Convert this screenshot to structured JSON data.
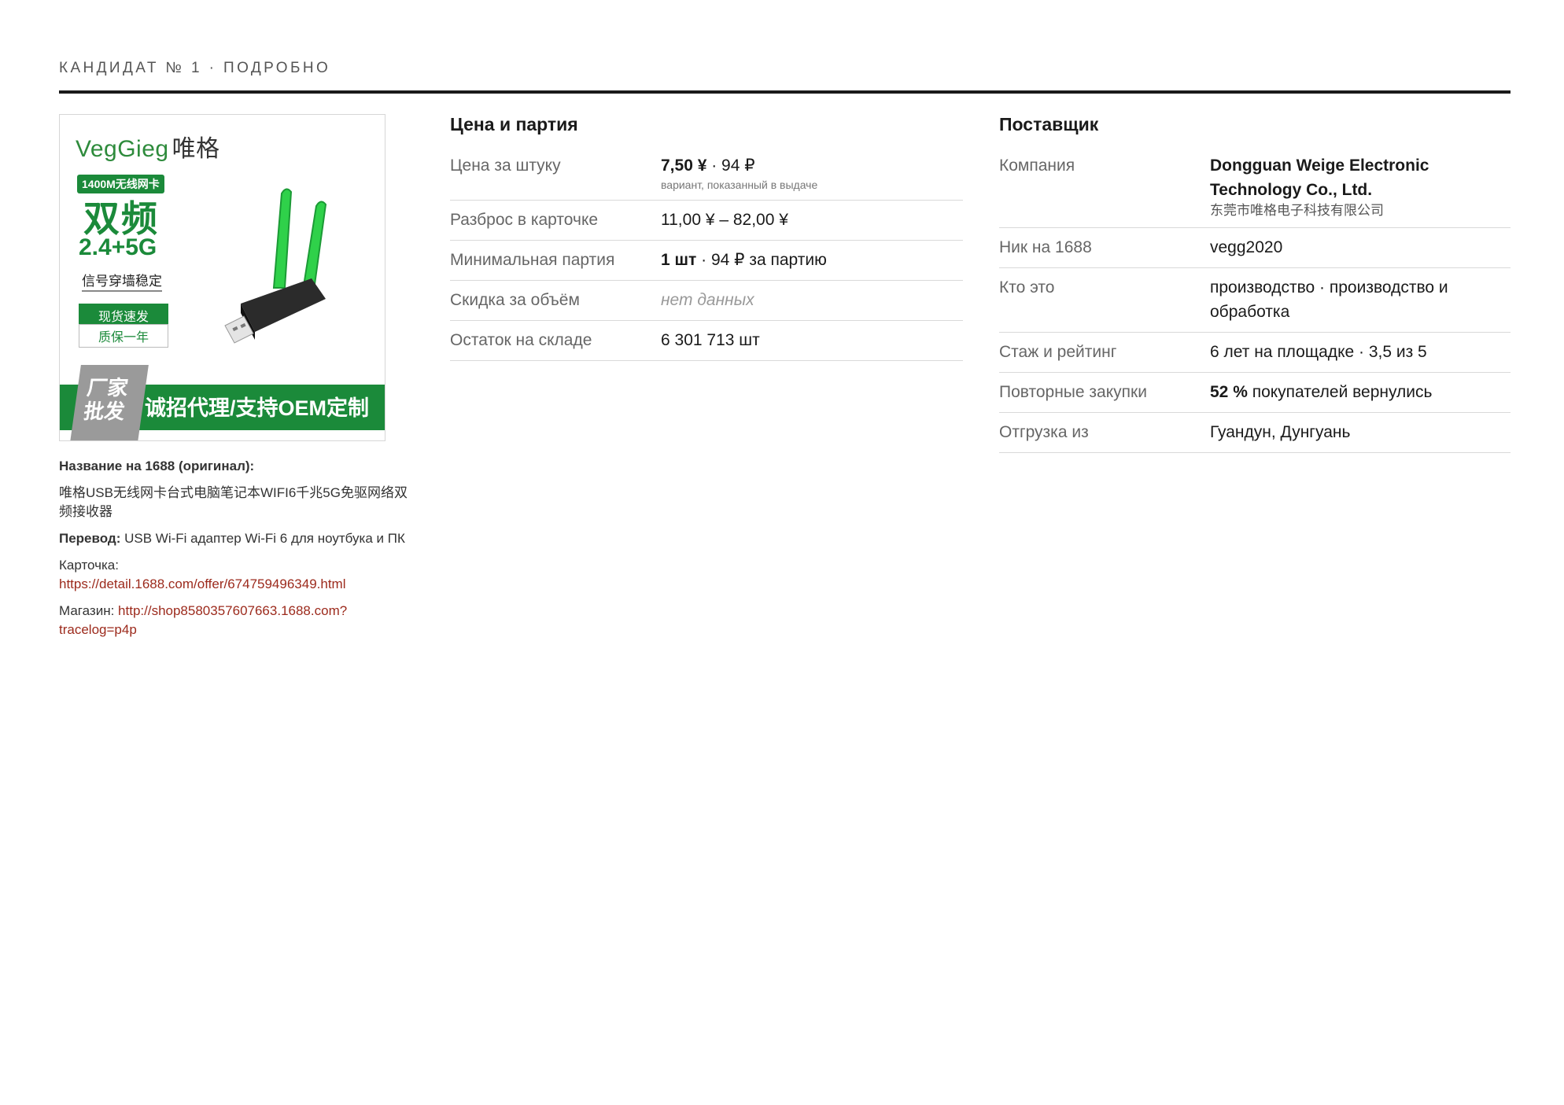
{
  "header": {
    "title": "КАНДИДАТ № 1 · ПОДРОБНО"
  },
  "product_image": {
    "brand": "VegGieg",
    "brand_cn": "唯格",
    "badge": "1400M无线网卡",
    "big_text": "双频",
    "band_text": "2.4+5G",
    "signal_text": "信号穿墙稳定",
    "pill1": "现货速发",
    "pill2": "质保一年",
    "banner_tag": "厂家批发",
    "banner_text": "诚招代理/支持OEM定制",
    "accent_color": "#1b8a3a",
    "antenna_color": "#2fd14a"
  },
  "meta": {
    "title_label": "Название на 1688 (оригинал):",
    "title_value": "唯格USB无线网卡台式电脑笔记本WIFI6千兆5G免驱网络双频接收器",
    "translation_label": "Перевод:",
    "translation_value": "USB Wi-Fi адаптер Wi-Fi 6 для ноутбука и ПК",
    "card_label": "Карточка:",
    "card_url": "https://detail.1688.com/offer/674759496349.html",
    "shop_label": "Магазин:",
    "shop_url": "http://shop8580357607663.1688.com?tracelog=p4p"
  },
  "price": {
    "heading": "Цена и партия",
    "rows": [
      {
        "label": "Цена за штуку",
        "value_bold": "7,50 ¥",
        "value_rest": " · 94 ₽",
        "note": "вариант, показанный в выдаче"
      },
      {
        "label": "Разброс в карточке",
        "value": "11,00 ¥ – 82,00 ¥"
      },
      {
        "label": "Минимальная партия",
        "value_bold": "1 шт",
        "value_rest": " · 94 ₽ за партию"
      },
      {
        "label": "Скидка за объём",
        "value": "нет данных"
      },
      {
        "label": "Остаток на складе",
        "value": "6 301 713 шт"
      }
    ]
  },
  "supplier": {
    "heading": "Поставщик",
    "rows": [
      {
        "label": "Компания",
        "value_bold": "Dongguan Weige Electronic Technology Co., Ltd.",
        "note": "东莞市唯格电子科技有限公司"
      },
      {
        "label": "Ник на 1688",
        "value": "vegg2020"
      },
      {
        "label": "Кто это",
        "value": "производство · производство и обработка"
      },
      {
        "label": "Стаж и рейтинг",
        "value": "6 лет на площадке · 3,5 из 5"
      },
      {
        "label": "Повторные закупки",
        "value_bold": "52 %",
        "value_rest": " покупателей вернулись"
      },
      {
        "label": "Отгрузка из",
        "value": "Гуандун, Дунгуань"
      }
    ]
  }
}
